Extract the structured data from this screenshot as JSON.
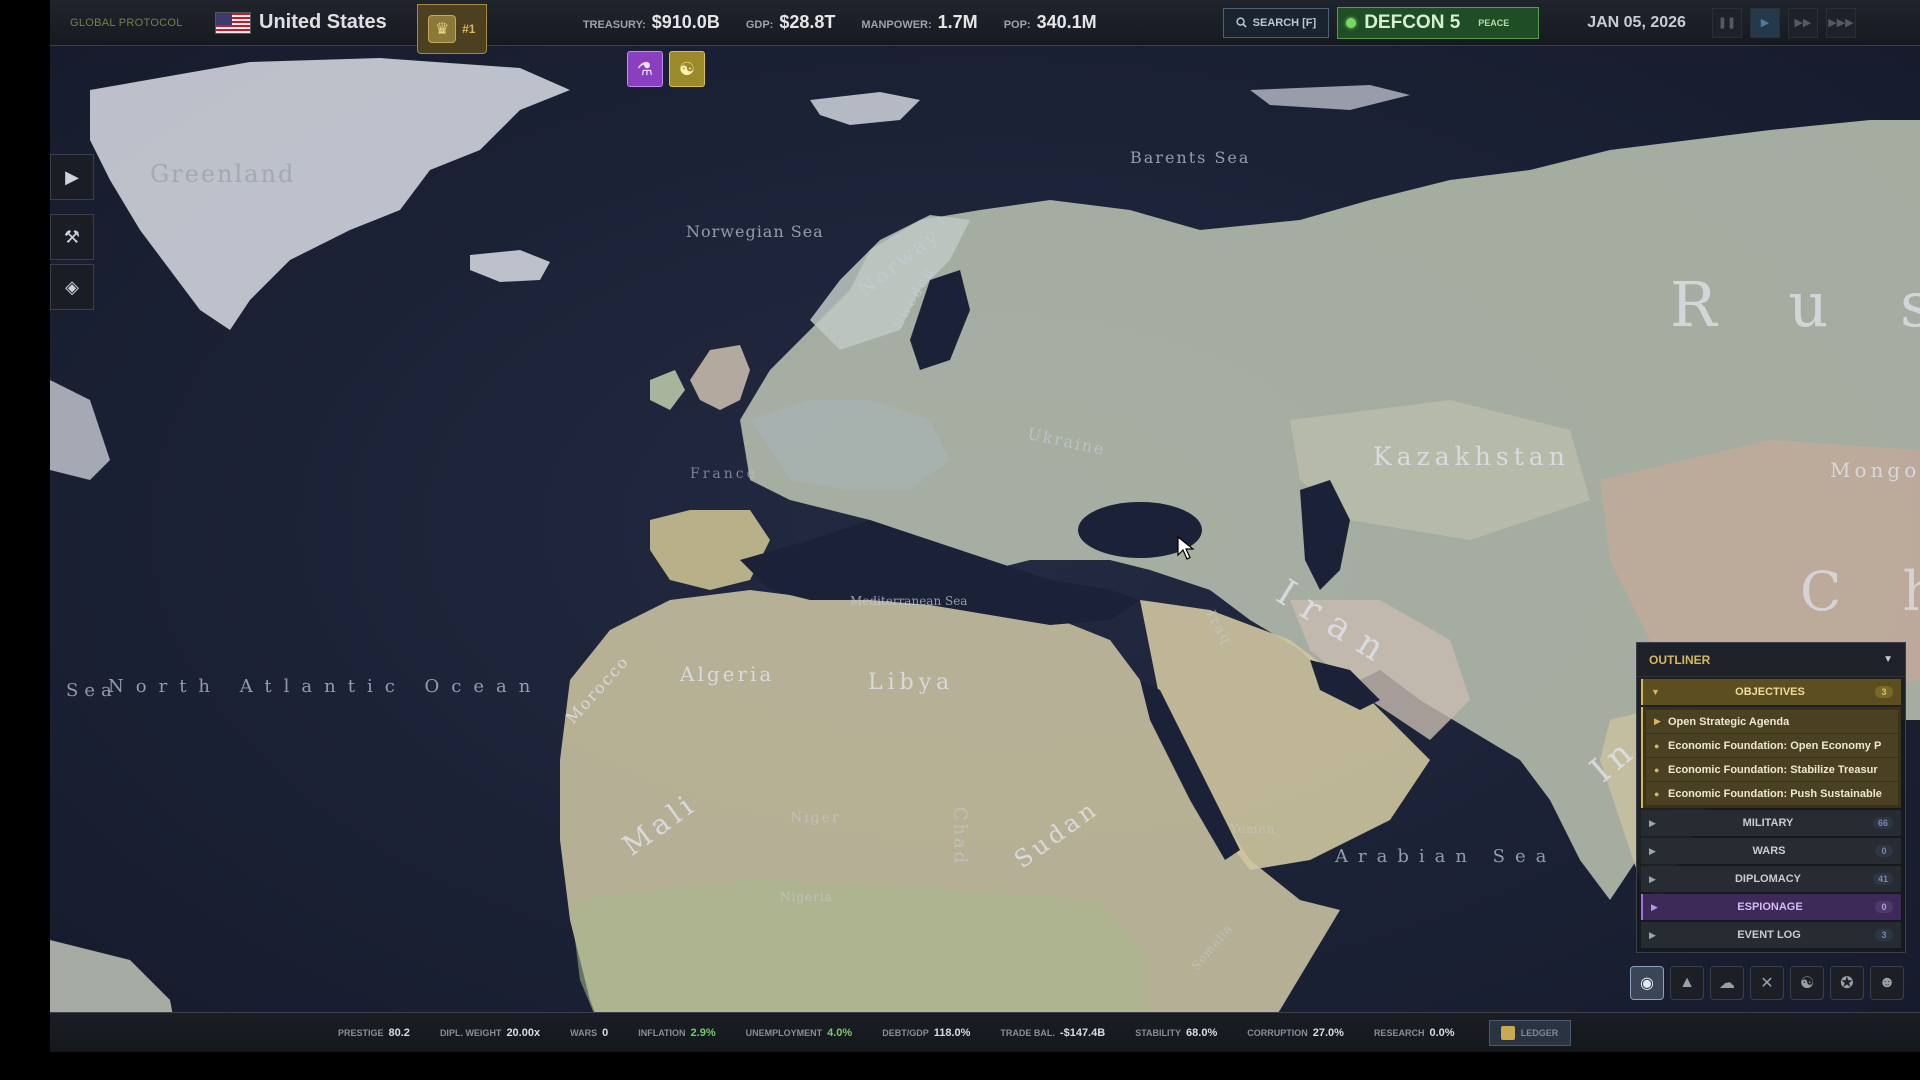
{
  "topbar": {
    "protocol": "GLOBAL PROTOCOL",
    "country": "United States",
    "rank": "#1",
    "stats": [
      {
        "key": "TREASURY:",
        "value": "$910.0B"
      },
      {
        "key": "GDP:",
        "value": "$28.8T"
      },
      {
        "key": "MANPOWER:",
        "value": "1.7M"
      },
      {
        "key": "POP:",
        "value": "340.1M"
      }
    ],
    "search_label": "SEARCH [F]",
    "defcon": "DEFCON 5",
    "peace": "PEACE",
    "date": "JAN 05, 2026"
  },
  "map_labels": {
    "greenland": "Greenland",
    "barents": "Barents Sea",
    "norwegian": "Norwegian Sea",
    "norway": "Norway",
    "sweden": "Sweden",
    "russia": "R u s s",
    "kazakhstan": "Kazakhstan",
    "mongolia": "Mongo",
    "china": "C h",
    "france": "France",
    "ukraine": "Ukraine",
    "mediterranean": "Mediterranean Sea",
    "atlantic": "North Atlantic Ocean",
    "sea_left": "Sea",
    "algeria": "Algeria",
    "libya": "Libya",
    "morocco": "Morocco",
    "iran": "Iran",
    "iraq": "Iraq",
    "mali": "Mali",
    "niger": "Niger",
    "chad": "Chad",
    "sudan": "Sudan",
    "nigeria": "Nigeria",
    "yemen": "Yemen",
    "arabian": "Arabian Sea",
    "india": "In",
    "somalia": "Somalia"
  },
  "outliner": {
    "title": "OUTLINER",
    "objectives": {
      "label": "OBJECTIVES",
      "count": "3"
    },
    "items": [
      "Open Strategic Agenda",
      "Economic Foundation: Open Economy P",
      "Economic Foundation: Stabilize Treasur",
      "Economic Foundation: Push Sustainable"
    ],
    "sections": [
      {
        "label": "MILITARY",
        "count": "66"
      },
      {
        "label": "WARS",
        "count": "0"
      },
      {
        "label": "DIPLOMACY",
        "count": "41"
      },
      {
        "label": "ESPIONAGE",
        "count": "0"
      },
      {
        "label": "EVENT LOG",
        "count": "3"
      }
    ]
  },
  "bottombar": {
    "stats": [
      {
        "key": "PRESTIGE",
        "value": "80.2"
      },
      {
        "key": "DIPL. WEIGHT",
        "value": "20.00x"
      },
      {
        "key": "WARS",
        "value": "0"
      },
      {
        "key": "INFLATION",
        "value": "2.9%"
      },
      {
        "key": "UNEMPLOYMENT",
        "value": "4.0%"
      },
      {
        "key": "DEBT/GDP",
        "value": "118.0%"
      },
      {
        "key": "TRADE BAL.",
        "value": "-$147.4B"
      },
      {
        "key": "STABILITY",
        "value": "68.0%"
      },
      {
        "key": "CORRUPTION",
        "value": "27.0%"
      },
      {
        "key": "RESEARCH",
        "value": "0.0%"
      }
    ],
    "ledger": "LEDGER"
  },
  "icons": {
    "search": "magnifier-icon",
    "lab": "flask-icon",
    "pact": "handshake-icon",
    "eagle": "eagle-icon"
  },
  "colors": {
    "accent_gold": "#d6b75b",
    "defcon_green": "#1f4d24",
    "espionage_purple": "#3e2a58",
    "ocean": "#1b2136"
  }
}
